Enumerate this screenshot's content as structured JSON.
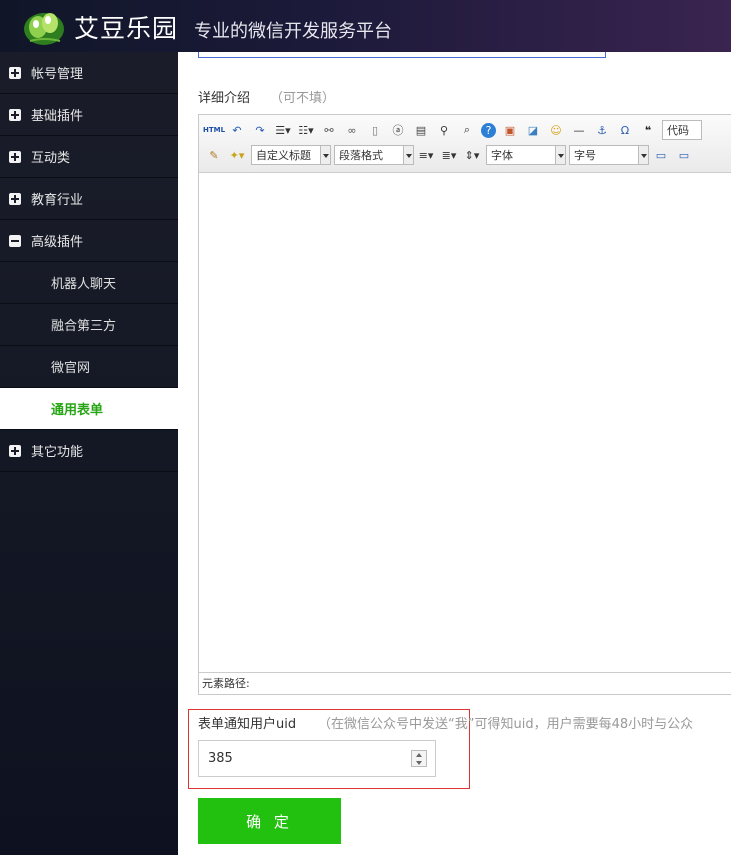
{
  "header": {
    "brand": "艾豆乐园",
    "tagline": "专业的微信开发服务平台"
  },
  "sidebar": {
    "items": [
      {
        "label": "帐号管理",
        "expanded": false
      },
      {
        "label": "基础插件",
        "expanded": false
      },
      {
        "label": "互动类",
        "expanded": false
      },
      {
        "label": "教育行业",
        "expanded": false
      },
      {
        "label": "高级插件",
        "expanded": true
      }
    ],
    "subitems": [
      {
        "label": "机器人聊天",
        "active": false
      },
      {
        "label": "融合第三方",
        "active": false
      },
      {
        "label": "微官网",
        "active": false
      },
      {
        "label": "通用表单",
        "active": true
      }
    ],
    "bottom_item": {
      "label": "其它功能",
      "expanded": false
    }
  },
  "form": {
    "detail": {
      "label": "详细介绍",
      "hint": "（可不填）"
    },
    "editor": {
      "toolbar_row1": [
        "html-icon",
        "undo-icon",
        "redo-icon",
        "unordered-list-icon",
        "ordered-list-icon",
        "unlink-icon",
        "link-icon",
        "new-doc-icon",
        "paste-text-icon",
        "print-icon",
        "find-icon",
        "preview-icon",
        "help-icon",
        "image-icon",
        "insert-image-icon",
        "emoticon-icon",
        "horizontal-rule-icon",
        "anchor-icon",
        "special-char-icon",
        "quote-icon"
      ],
      "html_label": "HTML",
      "code_select": "代码",
      "custom_heading": "自定义标题",
      "paragraph_format": "段落格式",
      "font_family": "字体",
      "font_size": "字号",
      "path_label": "元素路径:"
    },
    "uid": {
      "label": "表单通知用户uid",
      "hint": "（在微信公众号中发送“我”可得知uid，用户需要每48小时与公众",
      "value": "385"
    },
    "submit_label": "确 定"
  },
  "colors": {
    "accent_green": "#22c10f",
    "active_nav_text": "#27a515",
    "highlight_border": "#dd3333"
  }
}
